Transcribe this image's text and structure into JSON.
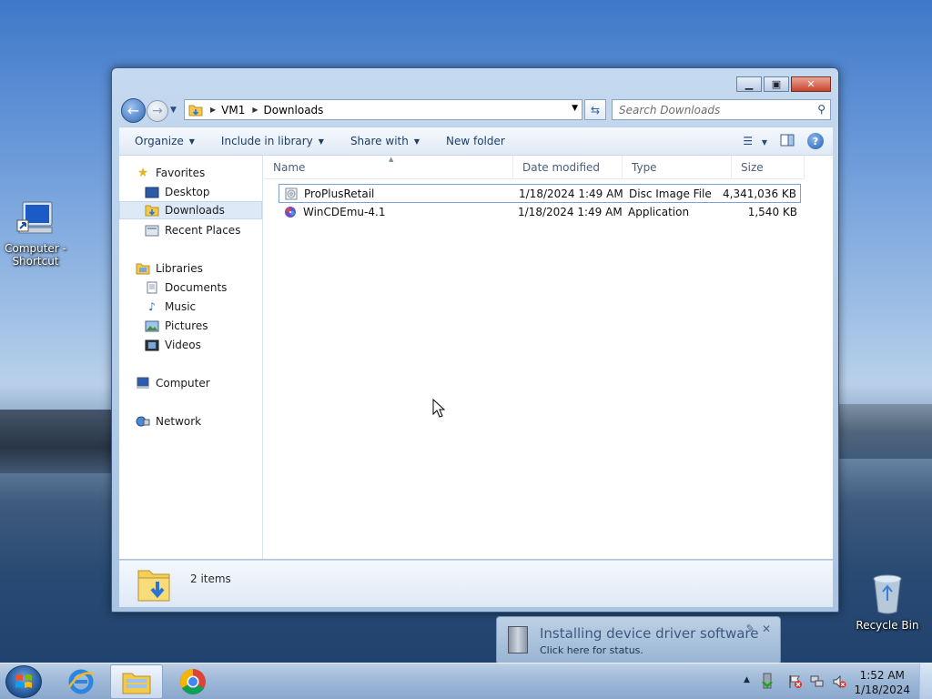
{
  "desktop": {
    "icons": [
      {
        "label": "Computer - Shortcut",
        "icon": "computer-icon"
      },
      {
        "label": "Recycle Bin",
        "icon": "recycle-bin-icon"
      }
    ]
  },
  "window": {
    "address": {
      "crumbs": [
        "VM1",
        "Downloads"
      ]
    },
    "search": {
      "placeholder": "Search Downloads"
    },
    "toolbar": {
      "organize": "Organize",
      "include": "Include in library",
      "share": "Share with",
      "new_folder": "New folder"
    },
    "nav": {
      "favorites": "Favorites",
      "desktop": "Desktop",
      "downloads": "Downloads",
      "recent": "Recent Places",
      "libraries": "Libraries",
      "documents": "Documents",
      "music": "Music",
      "pictures": "Pictures",
      "videos": "Videos",
      "computer": "Computer",
      "network": "Network"
    },
    "columns": {
      "name": "Name",
      "date": "Date modified",
      "type": "Type",
      "size": "Size"
    },
    "files": [
      {
        "name": "ProPlusRetail",
        "date": "1/18/2024 1:49 AM",
        "type": "Disc Image File",
        "size": "4,341,036 KB"
      },
      {
        "name": "WinCDEmu-4.1",
        "date": "1/18/2024 1:49 AM",
        "type": "Application",
        "size": "1,540 KB"
      }
    ],
    "details": {
      "count": "2 items"
    }
  },
  "notification": {
    "title": "Installing device driver software",
    "subtitle": "Click here for status."
  },
  "taskbar": {
    "clock_time": "1:52 AM",
    "clock_date": "1/18/2024"
  },
  "colors": {
    "accent": "#2f67b4",
    "selection": "#dde9f7"
  }
}
